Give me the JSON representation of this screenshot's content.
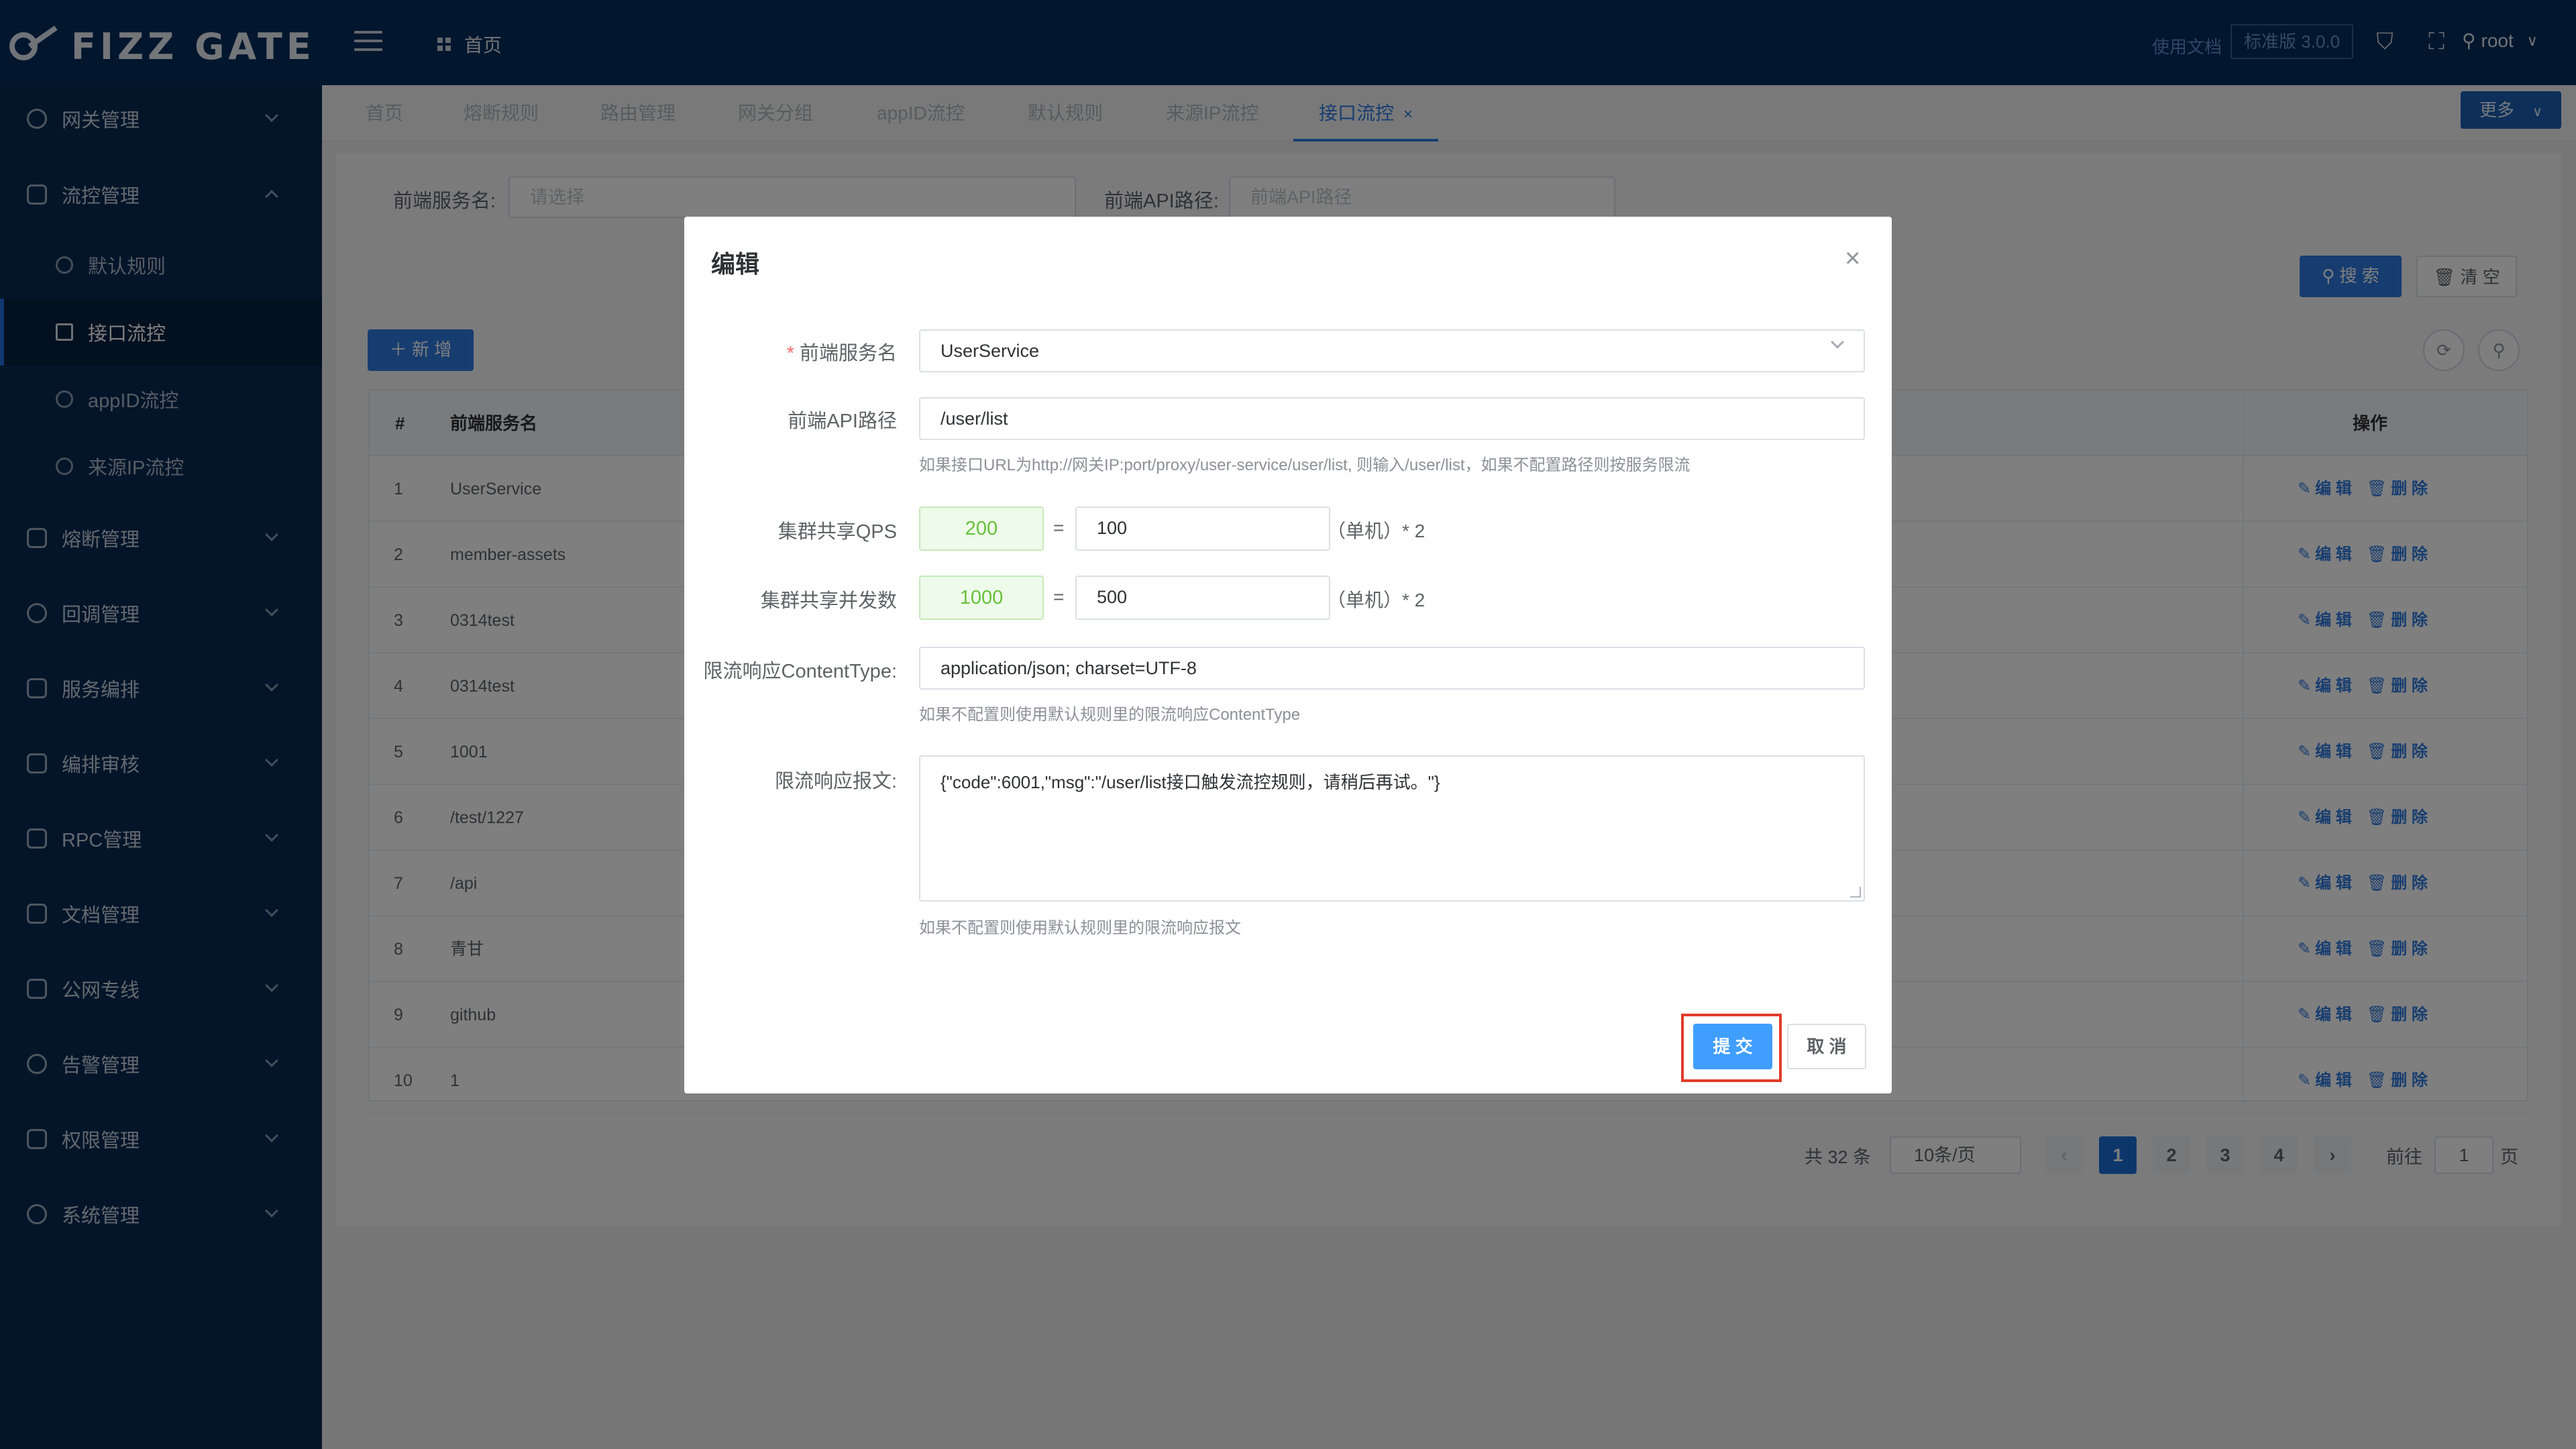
{
  "header": {
    "logo_text": "FIZZ GATE",
    "breadcrumb_home": "首页",
    "docs_link": "使用文档",
    "version": "标准版 3.0.0",
    "user": "root"
  },
  "sidebar": {
    "items": [
      {
        "label": "网关管理"
      },
      {
        "label": "流控管理",
        "expanded": true,
        "children": [
          {
            "label": "默认规则"
          },
          {
            "label": "接口流控",
            "active": true
          },
          {
            "label": "appID流控"
          },
          {
            "label": "来源IP流控"
          }
        ]
      },
      {
        "label": "熔断管理"
      },
      {
        "label": "回调管理"
      },
      {
        "label": "服务编排"
      },
      {
        "label": "编排审核"
      },
      {
        "label": "RPC管理"
      },
      {
        "label": "文档管理"
      },
      {
        "label": "公网专线"
      },
      {
        "label": "告警管理"
      },
      {
        "label": "权限管理"
      },
      {
        "label": "系统管理"
      }
    ]
  },
  "tabs": {
    "items": [
      "首页",
      "熔断规则",
      "路由管理",
      "网关分组",
      "appID流控",
      "默认规则",
      "来源IP流控",
      "接口流控"
    ],
    "close": "×",
    "more": "更多"
  },
  "filters": {
    "service_label": "前端服务名:",
    "service_placeholder": "请选择",
    "api_label": "前端API路径:",
    "api_placeholder": "前端API路径",
    "search": "搜 索",
    "clear": "清 空",
    "add": "新 增"
  },
  "table": {
    "columns": [
      "#",
      "前端服务名",
      "操作"
    ],
    "rows": [
      {
        "no": "1",
        "service": "UserService"
      },
      {
        "no": "2",
        "service": "member-assets"
      },
      {
        "no": "3",
        "service": "0314test"
      },
      {
        "no": "4",
        "service": "0314test"
      },
      {
        "no": "5",
        "service": "1001"
      },
      {
        "no": "6",
        "service": "/test/1227"
      },
      {
        "no": "7",
        "service": "/api"
      },
      {
        "no": "8",
        "service": "青甘"
      },
      {
        "no": "9",
        "service": "github"
      },
      {
        "no": "10",
        "service": "1"
      }
    ],
    "edit": "编 辑",
    "delete": "删 除"
  },
  "pagination": {
    "total": "共 32 条",
    "page_size": "10条/页",
    "pages": [
      "1",
      "2",
      "3",
      "4"
    ],
    "current": "1",
    "goto_label": "前往",
    "goto_value": "1",
    "goto_suffix": "页"
  },
  "modal": {
    "title": "编辑",
    "service_label": "前端服务名",
    "service_value": "UserService",
    "api_label": "前端API路径",
    "api_value": "/user/list",
    "api_hint": "如果接口URL为http://网关IP:port/proxy/user-service/user/list, 则输入/user/list，如果不配置路径则按服务限流",
    "qps_label": "集群共享QPS",
    "qps_total": "200",
    "qps_single": "100",
    "concurrency_label": "集群共享并发数",
    "concurrency_total": "1000",
    "concurrency_single": "500",
    "equals": "=",
    "unit_suffix": "（单机）* 2",
    "content_type_label": "限流响应ContentType:",
    "content_type_value": "application/json; charset=UTF-8",
    "content_type_hint": "如果不配置则使用默认规则里的限流响应ContentType",
    "body_label": "限流响应报文:",
    "body_value": "{\"code\":6001,\"msg\":\"/user/list接口触发流控规则，请稍后再试。\"}",
    "body_hint": "如果不配置则使用默认规则里的限流响应报文",
    "submit": "提 交",
    "cancel": "取 消"
  },
  "colors": {
    "header_bg": "#042c5c",
    "sidebar_bg": "#082b54",
    "primary": "#409eff",
    "highlight": "#e23b2b",
    "success": "#67c23a"
  }
}
